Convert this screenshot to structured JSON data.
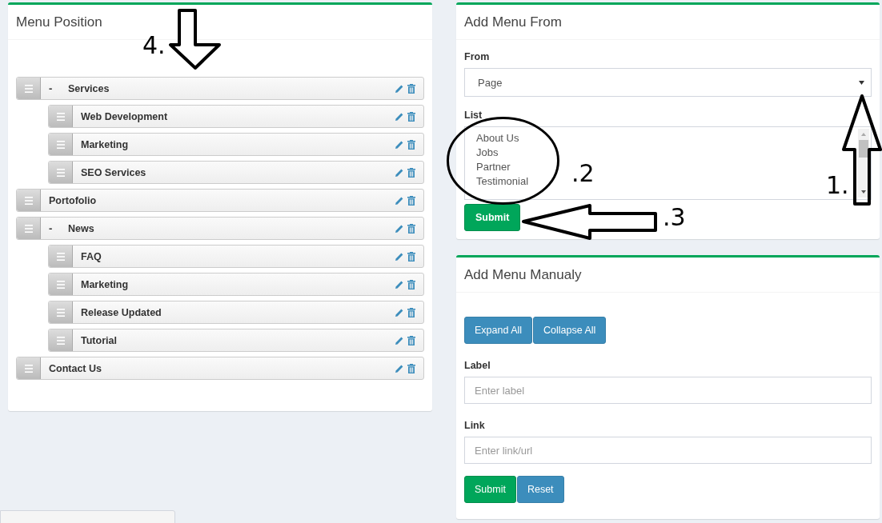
{
  "menu_position": {
    "title": "Menu Position",
    "items": [
      {
        "label": "Services",
        "toggle": "-",
        "children": [
          {
            "label": "Web Development"
          },
          {
            "label": "Marketing"
          },
          {
            "label": "SEO Services"
          }
        ]
      },
      {
        "label": "Portofolio"
      },
      {
        "label": "News",
        "toggle": "-",
        "children": [
          {
            "label": "FAQ"
          },
          {
            "label": "Marketing"
          },
          {
            "label": "Release Updated"
          },
          {
            "label": "Tutorial"
          }
        ]
      },
      {
        "label": "Contact Us"
      }
    ]
  },
  "add_from": {
    "title": "Add Menu From",
    "from_label": "From",
    "from_value": "Page",
    "list_label": "List",
    "list_items": [
      "About Us",
      "Jobs",
      "Partner",
      "Testimonial"
    ],
    "submit": "Submit"
  },
  "add_manual": {
    "title": "Add Menu Manualy",
    "buttons": [
      "Expand All",
      "Collapse All"
    ],
    "fields": [
      {
        "label": "Label",
        "placeholder": "Enter label"
      },
      {
        "label": "Link",
        "placeholder": "Enter link/url"
      }
    ],
    "actions": [
      {
        "label": "Submit",
        "kind": "primary"
      },
      {
        "label": "Reset",
        "kind": "secondary"
      }
    ]
  },
  "annotations": [
    {
      "kind": "uparrow",
      "label": "1."
    },
    {
      "kind": "ellipse",
      "label": ".2"
    },
    {
      "kind": "leftarrow",
      "label": ".3"
    },
    {
      "kind": "downarrow",
      "label": "4."
    }
  ]
}
